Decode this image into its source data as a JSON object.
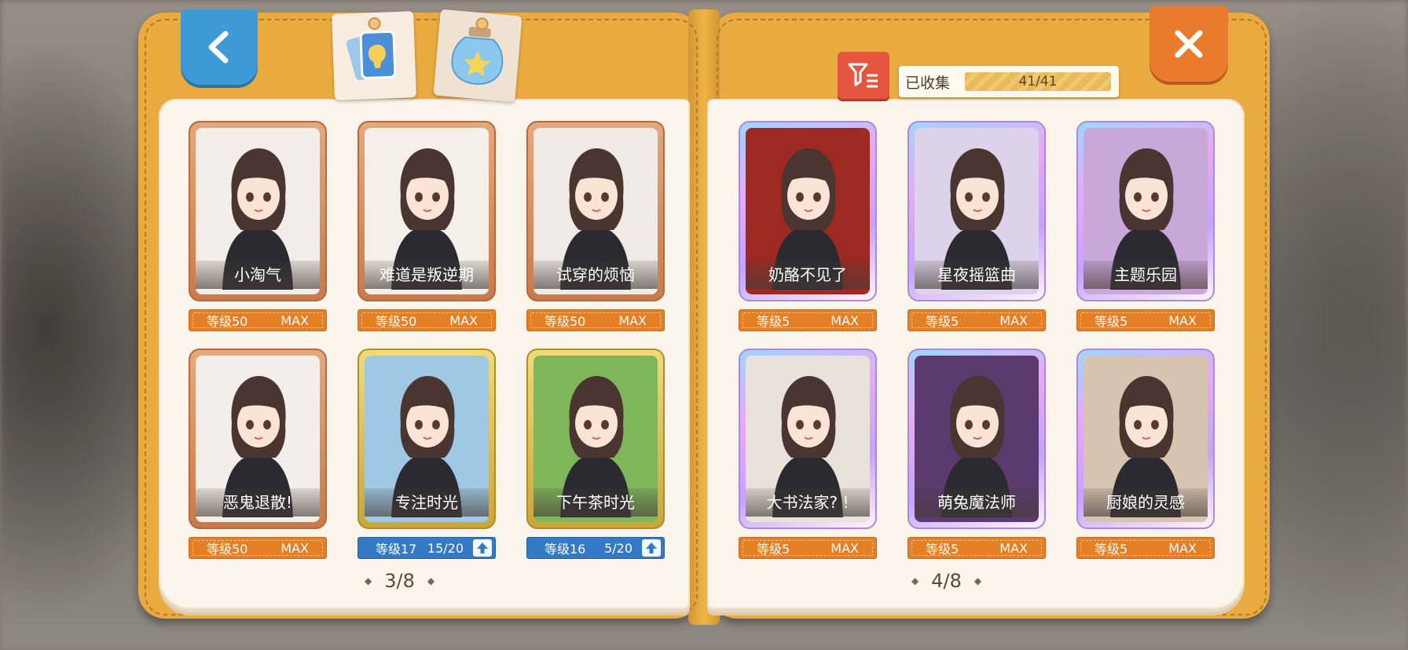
{
  "header": {
    "collected_label": "已收集",
    "collected_value": "41/41"
  },
  "left_page": {
    "page_number": "3/8",
    "cards": [
      {
        "title": "小淘气",
        "level": "等级50",
        "status": "MAX",
        "rarity": "bronze",
        "bg": "#f2ede8"
      },
      {
        "title": "难道是叛逆期",
        "level": "等级50",
        "status": "MAX",
        "rarity": "bronze",
        "bg": "#f4efe9"
      },
      {
        "title": "试穿的烦恼",
        "level": "等级50",
        "status": "MAX",
        "rarity": "bronze",
        "bg": "#efeae6"
      },
      {
        "title": "恶鬼退散!",
        "level": "等级50",
        "status": "MAX",
        "rarity": "bronze",
        "bg": "#f3eee9"
      },
      {
        "title": "专注时光",
        "level": "等级17",
        "status": "15/20",
        "rarity": "gold",
        "bg": "#9ec8e4",
        "upgradeable": true
      },
      {
        "title": "下午茶时光",
        "level": "等级16",
        "status": "5/20",
        "rarity": "gold",
        "bg": "#7fb65a",
        "upgradeable": true
      }
    ]
  },
  "right_page": {
    "page_number": "4/8",
    "cards": [
      {
        "title": "奶酪不见了",
        "level": "等级5",
        "status": "MAX",
        "rarity": "prism",
        "bg": "#9c2a22"
      },
      {
        "title": "星夜摇篮曲",
        "level": "等级5",
        "status": "MAX",
        "rarity": "prism",
        "bg": "#dcd3ea"
      },
      {
        "title": "主题乐园",
        "level": "等级5",
        "status": "MAX",
        "rarity": "prism",
        "bg": "#c9a7d8"
      },
      {
        "title": "大书法家? !",
        "level": "等级5",
        "status": "MAX",
        "rarity": "prism",
        "bg": "#e8e2da"
      },
      {
        "title": "萌兔魔法师",
        "level": "等级5",
        "status": "MAX",
        "rarity": "prism",
        "bg": "#5b3a6e"
      },
      {
        "title": "厨娘的灵感",
        "level": "等级5",
        "status": "MAX",
        "rarity": "prism",
        "bg": "#d6c4b0"
      }
    ]
  },
  "colors": {
    "book_cover": "#e9ab3f",
    "back_button": "#3e9ad6",
    "close_button": "#ea7a2c",
    "filter_button": "#e55540",
    "level_orange": "#e47f25",
    "level_blue": "#3479c4"
  },
  "icons": {
    "back": "chevron-left-icon",
    "close": "close-icon",
    "filter": "filter-list-icon",
    "tab_cards": "cards-icon",
    "tab_jar": "star-jar-icon",
    "upgrade": "arrow-up-icon"
  }
}
